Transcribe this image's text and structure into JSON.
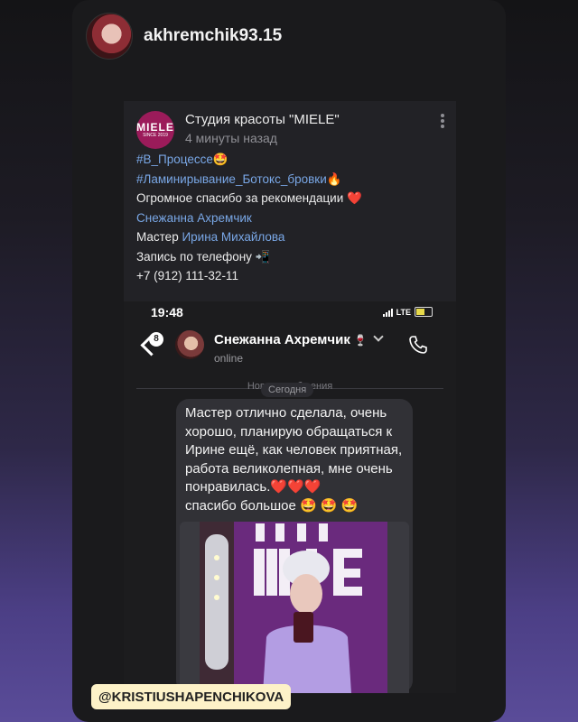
{
  "story": {
    "username": "akhremchik93.15",
    "mention": "@KRISTIUSHAPENCHIKOVA"
  },
  "post": {
    "group_name": "Студия красоты \"MIELE\"",
    "logo_text": "MIELE",
    "logo_sub": "SINCE 2019",
    "time": "4 минуты назад",
    "hashtag1": "#В_Процессе",
    "hashtag1_emoji": "🤩",
    "hashtag2": "#Ламинирывание_Ботокс_бровки",
    "hashtag2_emoji": "🔥",
    "thanks": "Огромное спасибо за рекомендации",
    "thanks_emoji": "❤️",
    "recommender": "Снежанна Ахремчик",
    "master_label": "Мастер",
    "master_name": "Ирина Михайлова",
    "booking": "Запись по телефону",
    "booking_emoji": "📲",
    "phone": "+7 (912) 111-32-11"
  },
  "screenshot": {
    "time": "19:48",
    "network": "LTE",
    "unread_count": "8",
    "contact_name": "Снежанна Ахремчик",
    "contact_emoji": "🍷",
    "contact_status": "online",
    "new_messages": "Новые сообщения",
    "today": "Сегодня",
    "message_text": "Мастер отлично сделала, очень хорошо, планирую обращаться к Ирине ещё, как человек приятная, работа великолепная, мне очень понравилась.",
    "message_hearts": "❤️❤️❤️",
    "message_end": "спасибо большое",
    "message_end_emoji": "🤩 🤩 🤩",
    "photo_wall_text": "MAKE UP MIELE"
  },
  "colors": {
    "link": "#79a7e6",
    "logo_bg": "#9b1b5a",
    "mention_bg": "#fdf2c8"
  }
}
